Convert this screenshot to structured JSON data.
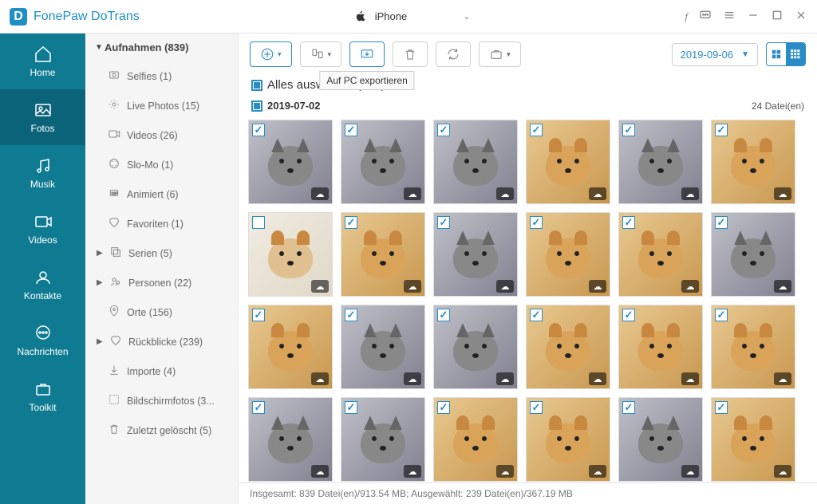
{
  "app": {
    "title": "FonePaw DoTrans"
  },
  "device": {
    "name": "iPhone"
  },
  "sidebar": {
    "items": [
      {
        "label": "Home"
      },
      {
        "label": "Fotos"
      },
      {
        "label": "Musik"
      },
      {
        "label": "Videos"
      },
      {
        "label": "Kontakte"
      },
      {
        "label": "Nachrichten"
      },
      {
        "label": "Toolkit"
      }
    ]
  },
  "subnav": {
    "header": "Aufnahmen (839)",
    "items": [
      {
        "label": "Selfies (1)"
      },
      {
        "label": "Live Photos (15)"
      },
      {
        "label": "Videos (26)"
      },
      {
        "label": "Slo-Mo (1)"
      },
      {
        "label": "Animiert (6)"
      },
      {
        "label": "Favoriten (1)"
      },
      {
        "label": "Serien (5)",
        "caret": true
      },
      {
        "label": "Personen (22)",
        "caret": true
      },
      {
        "label": "Orte (156)"
      },
      {
        "label": "Rückblicke (239)",
        "caret": true
      },
      {
        "label": "Importe (4)"
      },
      {
        "label": "Bildschirmfotos (3..."
      },
      {
        "label": "Zuletzt gelöscht (5)"
      }
    ]
  },
  "toolbar": {
    "export_tooltip": "Auf PC exportieren",
    "date": "2019-09-06"
  },
  "main": {
    "select_all": "Alles auswählen (839)",
    "group_date": "2019-07-02",
    "file_count": "24 Datei(en)",
    "thumbs": [
      {
        "t": "cat",
        "c": true
      },
      {
        "t": "cat",
        "c": true
      },
      {
        "t": "cat",
        "c": true
      },
      {
        "t": "dog",
        "c": true
      },
      {
        "t": "cat",
        "c": true
      },
      {
        "t": "dog",
        "c": true
      },
      {
        "t": "light",
        "c": false
      },
      {
        "t": "dog",
        "c": true
      },
      {
        "t": "cat",
        "c": true
      },
      {
        "t": "dog",
        "c": true
      },
      {
        "t": "dog",
        "c": true
      },
      {
        "t": "cat",
        "c": true
      },
      {
        "t": "dog",
        "c": true
      },
      {
        "t": "cat",
        "c": true
      },
      {
        "t": "cat",
        "c": true
      },
      {
        "t": "dog",
        "c": true
      },
      {
        "t": "dog",
        "c": true
      },
      {
        "t": "dog",
        "c": true
      },
      {
        "t": "cat",
        "c": true
      },
      {
        "t": "cat",
        "c": true
      },
      {
        "t": "dog",
        "c": true
      },
      {
        "t": "dog",
        "c": true
      },
      {
        "t": "cat",
        "c": true
      },
      {
        "t": "dog",
        "c": true
      }
    ]
  },
  "status": {
    "text": "Insgesamt: 839 Datei(en)/913.54 MB; Ausgewählt: 239 Datei(en)/367.19 MB"
  }
}
